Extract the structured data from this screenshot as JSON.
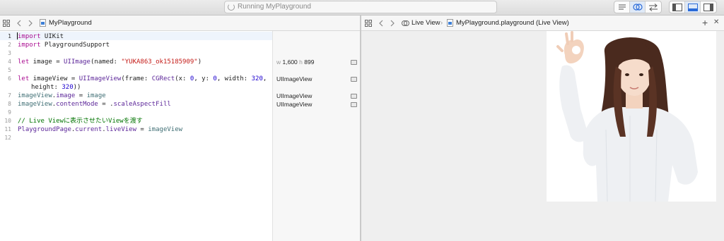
{
  "toolbar": {
    "status_text": "Running MyPlayground",
    "editor_buttons": [
      "standard-editor",
      "assistant-editor",
      "version-editor"
    ],
    "layout_buttons": [
      "navigator",
      "debug-area",
      "utilities"
    ]
  },
  "editor_jumpbar": {
    "file_name": "MyPlayground"
  },
  "assistant_jumpbar": {
    "crumb_1": "Live View",
    "crumb_2": "MyPlayground.playground (Live View)",
    "add_label": "+",
    "close_label": "✕"
  },
  "code": {
    "line_numbers": [
      "1",
      "2",
      "3",
      "4",
      "5",
      "6",
      "",
      "7",
      "8",
      "9",
      "10",
      "11",
      "12"
    ]
  },
  "results": {
    "r1_w_label": "w",
    "r1_w_value": "1,600",
    "r1_h_label": "h",
    "r1_h_value": "899",
    "r2": "UIImageView",
    "r3": "UIImageView",
    "r4": "UIImageView"
  },
  "live_view": {
    "image_description": "photo"
  }
}
